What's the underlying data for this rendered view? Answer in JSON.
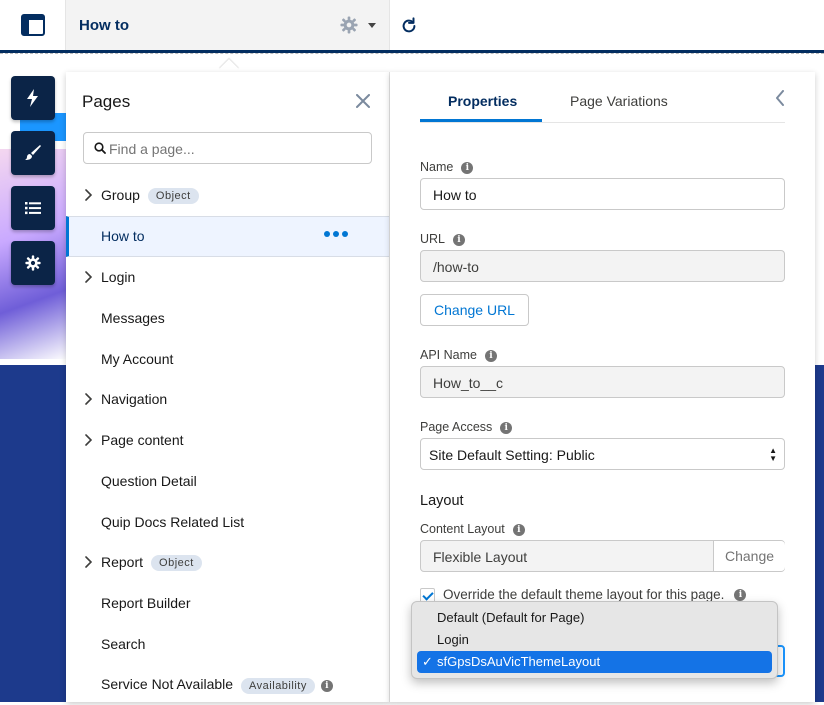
{
  "topbar": {
    "page_name": "How to"
  },
  "pages_panel": {
    "title": "Pages",
    "search_placeholder": "Find a page...",
    "items": [
      {
        "label": "Group",
        "badge": "Object",
        "expandable": true,
        "active": false
      },
      {
        "label": "How to",
        "badge": "",
        "expandable": false,
        "active": true
      },
      {
        "label": "Login",
        "badge": "",
        "expandable": true,
        "active": false
      },
      {
        "label": "Messages",
        "badge": "",
        "expandable": false,
        "active": false
      },
      {
        "label": "My Account",
        "badge": "",
        "expandable": false,
        "active": false
      },
      {
        "label": "Navigation",
        "badge": "",
        "expandable": true,
        "active": false
      },
      {
        "label": "Page content",
        "badge": "",
        "expandable": true,
        "active": false
      },
      {
        "label": "Question Detail",
        "badge": "",
        "expandable": false,
        "active": false
      },
      {
        "label": "Quip Docs Related List",
        "badge": "",
        "expandable": false,
        "active": false
      },
      {
        "label": "Report",
        "badge": "Object",
        "expandable": true,
        "active": false
      },
      {
        "label": "Report Builder",
        "badge": "",
        "expandable": false,
        "active": false
      },
      {
        "label": "Search",
        "badge": "",
        "expandable": false,
        "active": false
      },
      {
        "label": "Service Not Available",
        "badge": "Availability",
        "expandable": false,
        "active": false
      }
    ]
  },
  "properties_panel": {
    "tabs": [
      "Properties",
      "Page Variations"
    ],
    "name_label": "Name",
    "name_value": "How to",
    "url_label": "URL",
    "url_value": "/how-to",
    "change_url_label": "Change URL",
    "api_name_label": "API Name",
    "api_name_value": "How_to__c",
    "page_access_label": "Page Access",
    "page_access_value": "Site Default Setting: Public",
    "layout_section": "Layout",
    "content_layout_label": "Content Layout",
    "content_layout_value": "Flexible Layout",
    "change_label": "Change",
    "override_label": "Override the default theme layout for this page.",
    "override_checked": true
  },
  "theme_dropdown": {
    "options": [
      "Default (Default for Page)",
      "Login",
      "sfGpsDsAuVicThemeLayout"
    ],
    "selected": "sfGpsDsAuVicThemeLayout"
  },
  "colors": {
    "brand_dark": "#032d60",
    "accent": "#0176d3",
    "toolbar": "#0b2447",
    "selection": "#1473e6"
  }
}
